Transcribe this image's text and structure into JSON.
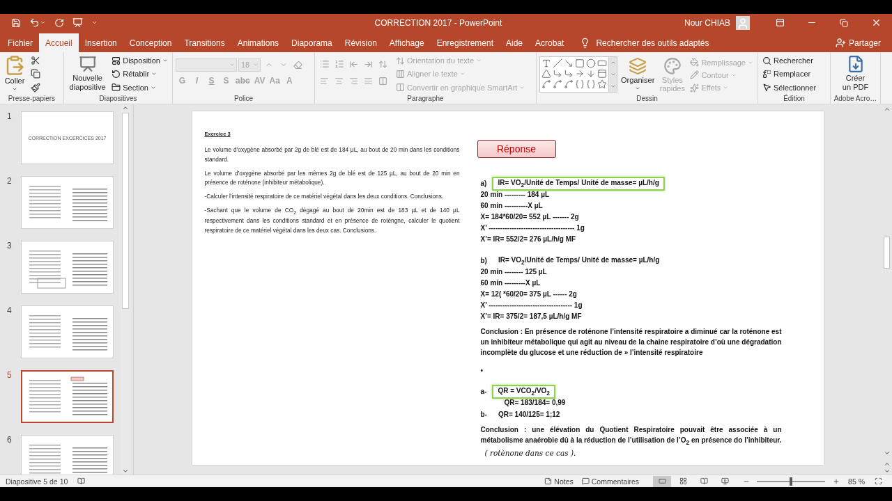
{
  "window": {
    "title": "CORRECTION 2017  -  PowerPoint",
    "user": "Nour CHIAB"
  },
  "tabs": [
    {
      "label": "Fichier",
      "selected": false
    },
    {
      "label": "Accueil",
      "selected": true
    },
    {
      "label": "Insertion",
      "selected": false
    },
    {
      "label": "Conception",
      "selected": false
    },
    {
      "label": "Transitions",
      "selected": false
    },
    {
      "label": "Animations",
      "selected": false
    },
    {
      "label": "Diaporama",
      "selected": false
    },
    {
      "label": "Révision",
      "selected": false
    },
    {
      "label": "Affichage",
      "selected": false
    },
    {
      "label": "Enregistrement",
      "selected": false
    },
    {
      "label": "Aide",
      "selected": false
    },
    {
      "label": "Acrobat",
      "selected": false
    }
  ],
  "tell_me": {
    "placeholder": "Rechercher des outils adaptés"
  },
  "share": "Partager",
  "ribbon": {
    "clipboard": {
      "paste": "Coller",
      "label": "Presse-papiers"
    },
    "slides": {
      "new_slide": "Nouvelle diapositive",
      "commands": [
        "Disposition",
        "Rétablir",
        "Section"
      ],
      "label": "Diapositives"
    },
    "font": {
      "disabled": true,
      "size": "18",
      "format_buttons": [
        "G",
        "I",
        "S",
        "S",
        "abc",
        "AV",
        "Aa",
        "A"
      ],
      "label": "Police"
    },
    "paragraph": {
      "disabled": true,
      "commands": [
        "Orientation du texte",
        "Aligner le texte",
        "Convertir en graphique SmartArt"
      ],
      "label": "Paragraphe"
    },
    "drawing": {
      "arrange": {
        "label": "Organiser",
        "disabled": false
      },
      "quick_styles": {
        "label": "Styles rapides",
        "disabled": true
      },
      "commands": [
        {
          "label": "Remplissage",
          "disabled": true
        },
        {
          "label": "Contour",
          "disabled": true
        },
        {
          "label": "Effets",
          "disabled": true
        }
      ],
      "label": "Dessin"
    },
    "editing": {
      "commands": [
        "Rechercher",
        "Remplacer",
        "Sélectionner"
      ],
      "label": "Édition"
    },
    "adobe": {
      "create_pdf": "Créer un PDF",
      "label": "Adobe Acro…"
    }
  },
  "thumbnails": [
    {
      "number": "1",
      "selected": false,
      "title": "CORRECTION EXCERCICES 2017"
    },
    {
      "number": "2",
      "selected": false
    },
    {
      "number": "3",
      "selected": false
    },
    {
      "number": "4",
      "selected": false
    },
    {
      "number": "5",
      "selected": true
    },
    {
      "number": "6",
      "selected": false
    }
  ],
  "slide": {
    "exercise": {
      "title": "Exercice 3",
      "paragraphs": [
        "Le volume d’oxygène absorbé par 2g de blé est de 184 µL, au bout de 20 min dans les conditions standard.",
        "Le volume d’oxygène absorbé par les mêmes 2g de blé est de 125 µL, au bout de 20 min en présence de roténone (inhibiteur métabolique).",
        "-Calculer l’intensité respiratoire de ce matériel végétal dans les deux conditions. Conclusions.",
        "-Sachant que le volume de CO$_{2}$ dégagé au bout de 20min est de 183 µL et de 140 µL respectivement dans les conditions standard et en présence de roténgne, calculer le quotient respiratoire de ce matériel végétal dans les deux cas. Conclusions."
      ]
    },
    "answer": {
      "title": "Réponse",
      "items": [
        {
          "kind": "formula",
          "label": "a)",
          "text": "IR= VO$_{2}$/Unité de Temps/ Unité de masse= µL/h/g",
          "highlighted": true
        },
        {
          "kind": "line",
          "text": "20 min --------- 184 µL"
        },
        {
          "kind": "line",
          "text": "60 min ----------X µL"
        },
        {
          "kind": "line",
          "text": "X= 184*60/20= 552 µL ------- 2g"
        },
        {
          "kind": "line",
          "text": "X’ ------------------------------------- 1g"
        },
        {
          "kind": "line",
          "text": "X’= IR= 552/2= 276 µL/h/g MF"
        },
        {
          "kind": "formula",
          "label": "b)",
          "text": "IR= VO$_{2}$/Unité de Temps/ Unité de masse= µL/h/g",
          "highlighted": false
        },
        {
          "kind": "line",
          "text": "20 min -------- 125 µL"
        },
        {
          "kind": "line",
          "text": "60 min ---------X µL"
        },
        {
          "kind": "line",
          "text": "X= 12( *60/20= 375 µL ------ 2g"
        },
        {
          "kind": "line",
          "text": "X’ ------------------------------------ 1g"
        },
        {
          "kind": "line",
          "text": "X’= IR= 375/2= 187,5 µL/h/g MF"
        },
        {
          "kind": "paragraph",
          "text": "Conclusion : En présence de roténone l’intensité respiratoire a diminué car la roténone est un inhibiteur métabolique qui agit au niveau de la chaine respiratoire d’où une dégradation incomplète du glucose et une réduction de » l’intensité respiratoire"
        },
        {
          "kind": "bullet",
          "text": "•"
        },
        {
          "kind": "formula",
          "label": "a-",
          "text": "QR = VCO$_{2}$/VO$_{2}$",
          "highlighted": true
        },
        {
          "kind": "subline",
          "text": "QR= 183/184= 0,99"
        },
        {
          "kind": "formula",
          "label": "b-",
          "text": "QR= 140/125= 1;12",
          "highlighted": false
        },
        {
          "kind": "paragraph",
          "text": "Conclusion : une élévation du Quotient Respiratoire pouvait être associée à un métabolisme anaérobie dû à la réduction de l’utilisation de l’O$_{2}$ en présence do l’inhibiteur.",
          "handwritten": "( rotènone dans ce cas )."
        }
      ]
    }
  },
  "status_bar": {
    "slide_info": "Diapositive 5 de 10",
    "notes": "Notes",
    "comments": "Commentaires",
    "views": [
      {
        "selected": true
      },
      {
        "selected": false
      },
      {
        "selected": false
      },
      {
        "selected": false
      }
    ],
    "zoom": {
      "level": 0.5,
      "reading": "85 %"
    }
  }
}
